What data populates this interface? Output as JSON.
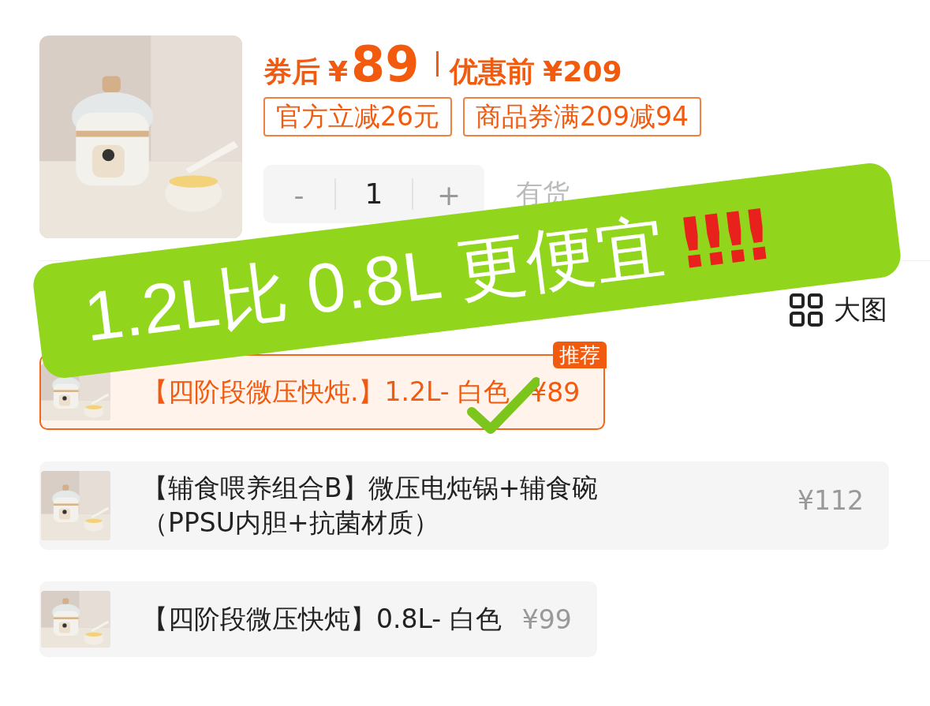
{
  "product": {
    "price_prefix": "券后",
    "currency": "¥",
    "price": "89",
    "original_label": "优惠前",
    "original_price": "¥209",
    "tags": [
      "官方立减26元",
      "商品券满209减94"
    ],
    "stepper": {
      "minus": "-",
      "value": "1",
      "plus": "+"
    },
    "stock": "有货"
  },
  "view_toggle": "大图",
  "options": [
    {
      "name": [
        "【四阶段微压快炖.】1.2L- 白色"
      ],
      "price": "¥89",
      "selected": true,
      "badge": "推荐"
    },
    {
      "name": [
        "【辅食喂养组合B】微压电炖锅+辅食碗",
        "（PPSU内胆+抗菌材质）"
      ],
      "price": "¥112",
      "selected": false
    },
    {
      "name": [
        "【四阶段微压快炖】0.8L- 白色"
      ],
      "price": "¥99",
      "selected": false
    }
  ],
  "annotation": {
    "text": "1.2L比 0.8L 更便宜",
    "marks": "‼‼",
    "checkmark": true
  }
}
